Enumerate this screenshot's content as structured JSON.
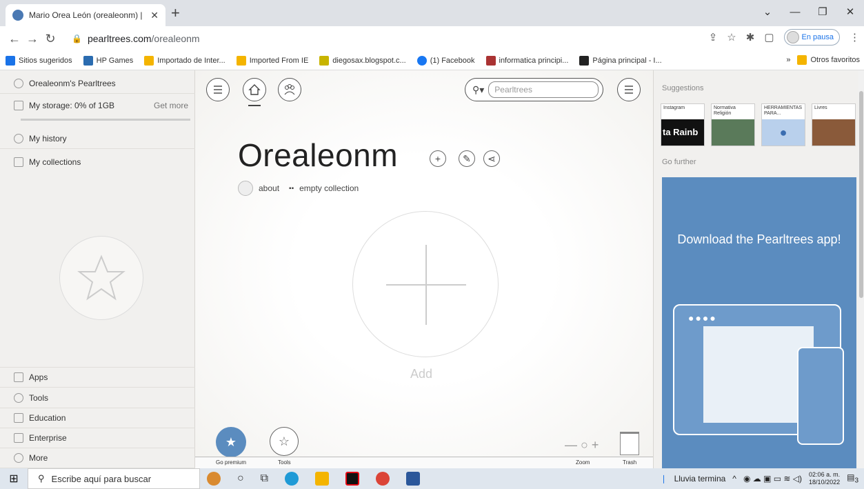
{
  "browser": {
    "tab_title": "Mario Orea León (orealeonm) | P",
    "url_host": "pearltrees.com",
    "url_path": "/orealeonm",
    "profile_status": "En pausa"
  },
  "bookmarks": {
    "items": [
      {
        "label": "Sitios sugeridos",
        "color": "#1a73e8"
      },
      {
        "label": "HP Games",
        "color": "#2b6cb0"
      },
      {
        "label": "Importado de Inter...",
        "color": "#f4b400"
      },
      {
        "label": "Imported From IE",
        "color": "#f4b400"
      },
      {
        "label": "diegosax.blogspot.c...",
        "color": "#c8b400"
      },
      {
        "label": "(1) Facebook",
        "color": "#1877f2"
      },
      {
        "label": "informatica principi...",
        "color": "#a33"
      },
      {
        "label": "Página principal - I...",
        "color": "#222"
      }
    ],
    "more": "»",
    "other": "Otros favoritos"
  },
  "left_panel": {
    "user": "Orealeonm's Pearltrees",
    "storage": "My storage: 0% of 1GB",
    "get_more": "Get more",
    "history": "My history",
    "collections": "My collections",
    "bottom": [
      "Apps",
      "Tools",
      "Education",
      "Enterprise",
      "More"
    ]
  },
  "center": {
    "search_placeholder": "Pearltrees",
    "title": "Orealeonm",
    "about": "about",
    "empty": "empty collection",
    "add_label": "Add",
    "go_premium": "Go premium",
    "tools": "Tools",
    "zoom": "Zoom",
    "trash": "Trash"
  },
  "right_panel": {
    "suggestions": "Suggestions",
    "thumbs": [
      {
        "label": "Instagram",
        "caption": "ta Rainb",
        "bg": "#111"
      },
      {
        "label": "Normativa Religión",
        "caption": "",
        "bg": "#5a7a5a"
      },
      {
        "label": "HERRAMIENTAS PARA...",
        "caption": "",
        "bg": "#b9d0ec"
      },
      {
        "label": "Livres",
        "caption": "",
        "bg": "#8a5a3a"
      }
    ],
    "go_further": "Go further",
    "ad_text": "Download the Pearltrees app!"
  },
  "taskbar": {
    "search_placeholder": "Escribe aquí para buscar",
    "weather": "Lluvia termina",
    "time": "02:06 a. m.",
    "date": "18/10/2022",
    "notifications": "3"
  }
}
